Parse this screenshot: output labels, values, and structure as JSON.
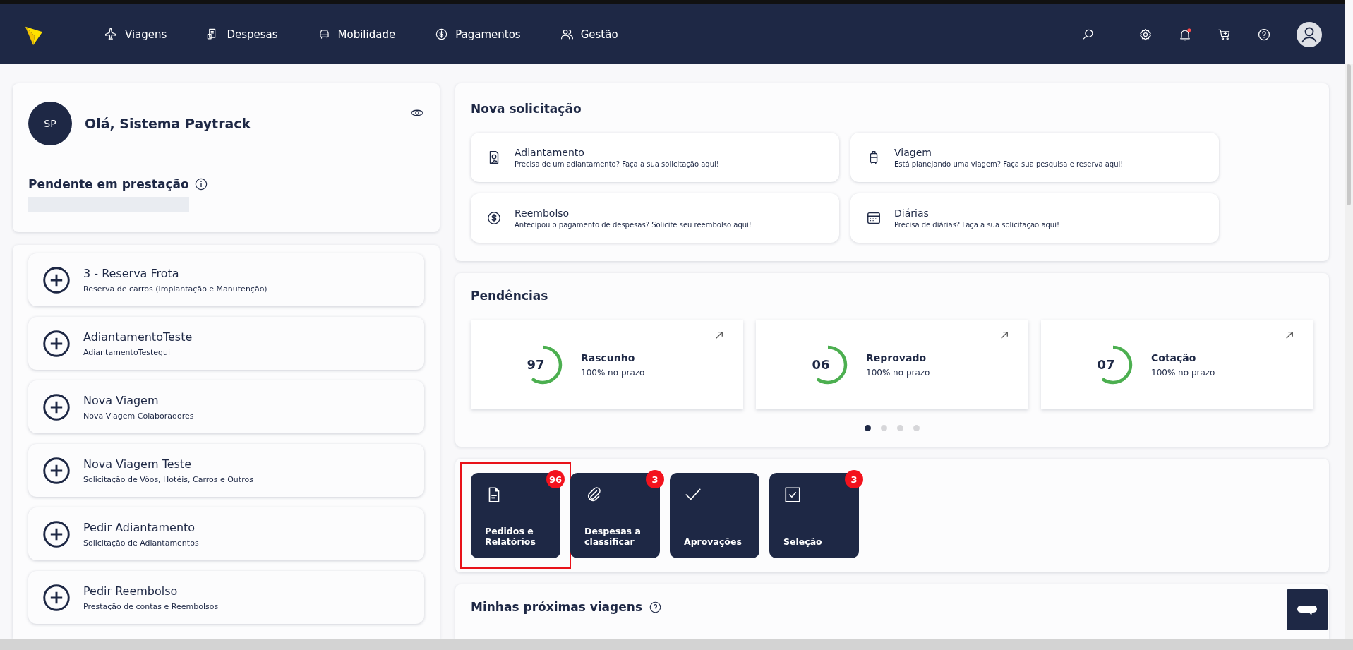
{
  "nav": [
    {
      "label": "Viagens",
      "kind": "plane"
    },
    {
      "label": "Despesas",
      "kind": "receipt"
    },
    {
      "label": "Mobilidade",
      "kind": "car"
    },
    {
      "label": "Pagamentos",
      "kind": "dollar"
    },
    {
      "label": "Gestão",
      "kind": "users"
    }
  ],
  "header_actions": {
    "notifications_unread": true
  },
  "profile": {
    "initials": "SP",
    "greeting": "Olá, Sistema Paytrack",
    "pending_title": "Pendente em prestação"
  },
  "shortcuts": [
    {
      "title": "3 - Reserva Frota",
      "subtitle": "Reserva de carros (Implantação e Manutenção)"
    },
    {
      "title": "AdiantamentoTeste",
      "subtitle": "AdiantamentoTestegui"
    },
    {
      "title": "Nova Viagem",
      "subtitle": "Nova Viagem Colaboradores"
    },
    {
      "title": "Nova Viagem Teste",
      "subtitle": "Solicitação de Vôos, Hotéis, Carros e Outros"
    },
    {
      "title": "Pedir Adiantamento",
      "subtitle": "Solicitação de Adiantamentos"
    },
    {
      "title": "Pedir Reembolso",
      "subtitle": "Prestação de contas e Reembolsos"
    }
  ],
  "new_request": {
    "title": "Nova solicitação",
    "options": [
      {
        "kind": "advance",
        "title": "Adiantamento",
        "text": "Precisa de um adiantamento? Faça a sua solicitação aqui!"
      },
      {
        "kind": "trip",
        "title": "Viagem",
        "text": "Está planejando uma viagem? Faça sua pesquisa e reserva aqui!"
      },
      {
        "kind": "refund",
        "title": "Reembolso",
        "text": "Antecipou o pagamento de despesas? Solicite seu reembolso aqui!"
      },
      {
        "kind": "daily",
        "title": "Diárias",
        "text": "Precisa de diárias? Faça a sua solicitação aqui!"
      }
    ]
  },
  "pending": {
    "title": "Pendências",
    "cards": [
      {
        "count": "97",
        "label": "Rascunho",
        "note": "100% no prazo",
        "level": 0.6
      },
      {
        "count": "06",
        "label": "Reprovado",
        "note": "100% no prazo",
        "level": 0.6
      },
      {
        "count": "07",
        "label": "Cotação",
        "note": "100% no prazo",
        "level": 0.6
      }
    ],
    "pages": [
      {
        "selected": true
      },
      {
        "selected": false
      },
      {
        "selected": false
      },
      {
        "selected": false
      }
    ]
  },
  "tiles": [
    {
      "kind": "document",
      "label": "Pedidos e Relatórios",
      "badge": "96",
      "highlighted": true
    },
    {
      "kind": "clip",
      "label": "Despesas a classificar",
      "badge": "3",
      "highlighted": false
    },
    {
      "kind": "check",
      "label": "Aprovações",
      "highlighted": false
    },
    {
      "kind": "checkbox",
      "label": "Seleção",
      "badge": "3",
      "highlighted": false
    }
  ],
  "upcoming": {
    "title": "Minhas próximas viagens"
  }
}
